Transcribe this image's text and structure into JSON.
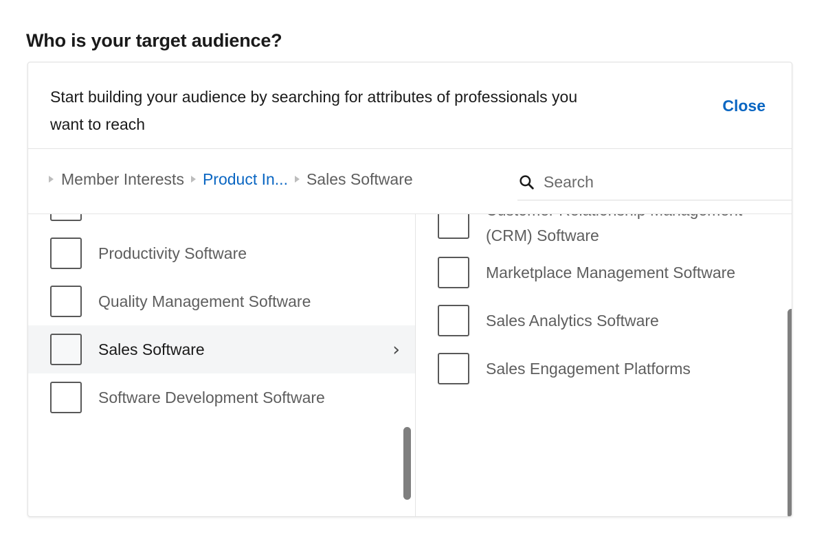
{
  "page": {
    "title": "Who is your target audience?"
  },
  "panel": {
    "header": {
      "description": "Start building your audience by searching for attributes of professionals you want to reach",
      "close_label": "Close"
    },
    "breadcrumbs": [
      {
        "label": "Member Interests",
        "state": "ancestor"
      },
      {
        "label": "Product In...",
        "state": "link"
      },
      {
        "label": "Sales Software",
        "state": "current"
      }
    ],
    "search": {
      "placeholder": "Search",
      "value": "",
      "icon": "search-icon"
    },
    "left_column": {
      "items": [
        {
          "label": "",
          "checked": false,
          "selected": false,
          "has_children": false,
          "clipped": true
        },
        {
          "label": "Productivity Software",
          "checked": false,
          "selected": false,
          "has_children": false
        },
        {
          "label": "Quality Management Software",
          "checked": false,
          "selected": false,
          "has_children": false
        },
        {
          "label": "Sales Software",
          "checked": false,
          "selected": true,
          "has_children": true,
          "chevron": "›"
        },
        {
          "label": "Software Development Software",
          "checked": false,
          "selected": false,
          "has_children": false
        }
      ],
      "scrollbar": {
        "visible": true
      }
    },
    "right_column": {
      "items": [
        {
          "label": "Customer Relationship Management (CRM) Software",
          "checked": false
        },
        {
          "label": "Marketplace Management Software",
          "checked": false
        },
        {
          "label": "Sales Analytics Software",
          "checked": false
        },
        {
          "label": "Sales Engagement Platforms",
          "checked": false
        }
      ],
      "scrollbar": {
        "visible": true
      }
    }
  },
  "colors": {
    "accent_link": "#0a66c2",
    "text_primary": "#1a1a1a",
    "text_secondary": "#5e5e5e",
    "selected_row_bg": "#f4f5f6",
    "border": "#e4e4e4",
    "scrollbar_thumb": "#7f7f7f"
  }
}
